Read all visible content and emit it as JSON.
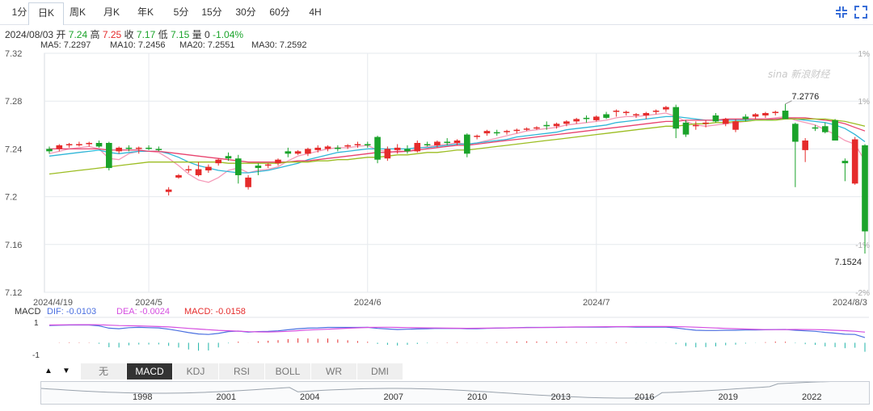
{
  "tabs": {
    "items": [
      "1分",
      "日K",
      "周K",
      "月K",
      "年K",
      "5分",
      "15分",
      "30分",
      "60分",
      "4H"
    ],
    "active": "日K"
  },
  "info": {
    "date": "2024/08/03",
    "open_label": "开",
    "open": "7.24",
    "high_label": "高",
    "high": "7.25",
    "close_label": "收",
    "close": "7.17",
    "low_label": "低",
    "low": "7.15",
    "volume_label": "量",
    "volume": "0",
    "change": "-1.04%"
  },
  "ma_legend": [
    {
      "label": "MA5: 7.2297",
      "color": "#f59ab8"
    },
    {
      "label": "MA10: 7.2456",
      "color": "#2fb6d8"
    },
    {
      "label": "MA20: 7.2551",
      "color": "#e8436e"
    },
    {
      "label": "MA30: 7.2592",
      "color": "#9cbd22"
    }
  ],
  "colors": {
    "up": "#e52b2b",
    "down": "#1aa32a",
    "grid": "#e6e9ee",
    "axis": "#555"
  },
  "watermark": "新浪财经",
  "chart_data": {
    "type": "candlestick",
    "y_ticks": [
      "7.32",
      "7.28",
      "7.24",
      "7.2",
      "7.16",
      "7.12"
    ],
    "y_tick_values": [
      7.32,
      7.28,
      7.24,
      7.2,
      7.16,
      7.12
    ],
    "ylim": [
      7.12,
      7.32
    ],
    "pct_ticks": [
      "1%",
      "1%",
      "-1%",
      "-2%"
    ],
    "x_labels": [
      "2024/4/19",
      "2024/5",
      "2024/6",
      "2024/7",
      "2024/8/3"
    ],
    "annotations": {
      "max": "7.2776",
      "min": "7.1524"
    },
    "candles": [
      [
        7.24,
        7.242,
        7.236,
        7.238
      ],
      [
        7.24,
        7.244,
        7.238,
        7.243
      ],
      [
        7.243,
        7.245,
        7.241,
        7.244
      ],
      [
        7.244,
        7.246,
        7.242,
        7.244
      ],
      [
        7.244,
        7.246,
        7.242,
        7.245
      ],
      [
        7.245,
        7.247,
        7.241,
        7.242
      ],
      [
        7.245,
        7.246,
        7.222,
        7.224
      ],
      [
        7.238,
        7.242,
        7.236,
        7.241
      ],
      [
        7.241,
        7.243,
        7.238,
        7.24
      ],
      [
        7.24,
        7.242,
        7.236,
        7.241
      ],
      [
        7.241,
        7.243,
        7.239,
        7.24
      ],
      [
        7.24,
        7.242,
        7.238,
        7.239
      ],
      [
        7.204,
        7.208,
        7.201,
        7.206
      ],
      [
        7.216,
        7.219,
        7.215,
        7.218
      ],
      [
        7.222,
        7.226,
        7.22,
        7.223
      ],
      [
        7.218,
        7.229,
        7.217,
        7.223
      ],
      [
        7.222,
        7.227,
        7.22,
        7.225
      ],
      [
        7.228,
        7.232,
        7.226,
        7.231
      ],
      [
        7.234,
        7.237,
        7.23,
        7.232
      ],
      [
        7.232,
        7.235,
        7.211,
        7.218
      ],
      [
        7.208,
        7.218,
        7.206,
        7.216
      ],
      [
        7.226,
        7.228,
        7.218,
        7.224
      ],
      [
        7.226,
        7.228,
        7.224,
        7.227
      ],
      [
        7.228,
        7.232,
        7.226,
        7.231
      ],
      [
        7.238,
        7.241,
        7.233,
        7.236
      ],
      [
        7.236,
        7.239,
        7.235,
        7.238
      ],
      [
        7.236,
        7.241,
        7.234,
        7.24
      ],
      [
        7.239,
        7.243,
        7.237,
        7.241
      ],
      [
        7.24,
        7.243,
        7.238,
        7.242
      ],
      [
        7.241,
        7.243,
        7.238,
        7.24
      ],
      [
        7.242,
        7.244,
        7.24,
        7.243
      ],
      [
        7.243,
        7.246,
        7.241,
        7.244
      ],
      [
        7.244,
        7.246,
        7.241,
        7.243
      ],
      [
        7.25,
        7.251,
        7.228,
        7.231
      ],
      [
        7.232,
        7.242,
        7.23,
        7.24
      ],
      [
        7.239,
        7.244,
        7.236,
        7.241
      ],
      [
        7.24,
        7.243,
        7.236,
        7.238
      ],
      [
        7.238,
        7.247,
        7.237,
        7.245
      ],
      [
        7.244,
        7.246,
        7.242,
        7.243
      ],
      [
        7.243,
        7.247,
        7.241,
        7.246
      ],
      [
        7.246,
        7.249,
        7.243,
        7.245
      ],
      [
        7.245,
        7.248,
        7.243,
        7.247
      ],
      [
        7.252,
        7.253,
        7.233,
        7.236
      ],
      [
        7.25,
        7.252,
        7.248,
        7.251
      ],
      [
        7.253,
        7.256,
        7.251,
        7.255
      ],
      [
        7.254,
        7.256,
        7.251,
        7.253
      ],
      [
        7.254,
        7.256,
        7.252,
        7.255
      ],
      [
        7.255,
        7.257,
        7.253,
        7.256
      ],
      [
        7.256,
        7.258,
        7.255,
        7.257
      ],
      [
        7.257,
        7.259,
        7.256,
        7.258
      ],
      [
        7.26,
        7.263,
        7.256,
        7.259
      ],
      [
        7.259,
        7.262,
        7.257,
        7.261
      ],
      [
        7.261,
        7.264,
        7.259,
        7.263
      ],
      [
        7.263,
        7.266,
        7.261,
        7.265
      ],
      [
        7.266,
        7.268,
        7.262,
        7.265
      ],
      [
        7.264,
        7.268,
        7.263,
        7.267
      ],
      [
        7.269,
        7.271,
        7.265,
        7.266
      ],
      [
        7.271,
        7.273,
        7.267,
        7.272
      ],
      [
        7.27,
        7.272,
        7.268,
        7.271
      ],
      [
        7.268,
        7.27,
        7.266,
        7.269
      ],
      [
        7.268,
        7.271,
        7.265,
        7.27
      ],
      [
        7.271,
        7.273,
        7.269,
        7.272
      ],
      [
        7.273,
        7.276,
        7.271,
        7.275
      ],
      [
        7.275,
        7.277,
        7.249,
        7.257
      ],
      [
        7.262,
        7.264,
        7.25,
        7.252
      ],
      [
        7.259,
        7.263,
        7.256,
        7.26
      ],
      [
        7.261,
        7.264,
        7.258,
        7.262
      ],
      [
        7.268,
        7.27,
        7.262,
        7.263
      ],
      [
        7.261,
        7.266,
        7.259,
        7.265
      ],
      [
        7.256,
        7.265,
        7.254,
        7.263
      ],
      [
        7.267,
        7.269,
        7.263,
        7.265
      ],
      [
        7.267,
        7.27,
        7.265,
        7.269
      ],
      [
        7.268,
        7.271,
        7.266,
        7.27
      ],
      [
        7.27,
        7.272,
        7.268,
        7.271
      ],
      [
        7.272,
        7.2776,
        7.265,
        7.265
      ],
      [
        7.261,
        7.262,
        7.208,
        7.246
      ],
      [
        7.239,
        7.249,
        7.229,
        7.247
      ],
      [
        7.258,
        7.26,
        7.255,
        7.257
      ],
      [
        7.259,
        7.262,
        7.253,
        7.254
      ],
      [
        7.264,
        7.265,
        7.249,
        7.247
      ],
      [
        7.23,
        7.232,
        7.213,
        7.228
      ],
      [
        7.211,
        7.25,
        7.21,
        7.248
      ],
      [
        7.243,
        7.244,
        7.1524,
        7.171
      ]
    ],
    "ma5": [
      7.236,
      7.238,
      7.24,
      7.241,
      7.242,
      7.24,
      7.232,
      7.231,
      7.236,
      7.238,
      7.238,
      7.237,
      7.232,
      7.226,
      7.219,
      7.214,
      7.212,
      7.216,
      7.222,
      7.224,
      7.22,
      7.222,
      7.223,
      7.225,
      7.23,
      7.234,
      7.236,
      7.238,
      7.24,
      7.241,
      7.241,
      7.242,
      7.243,
      7.239,
      7.238,
      7.237,
      7.238,
      7.24,
      7.242,
      7.243,
      7.244,
      7.245,
      7.244,
      7.245,
      7.247,
      7.249,
      7.251,
      7.253,
      7.255,
      7.256,
      7.257,
      7.258,
      7.26,
      7.261,
      7.262,
      7.263,
      7.264,
      7.266,
      7.267,
      7.267,
      7.268,
      7.269,
      7.27,
      7.267,
      7.263,
      7.26,
      7.259,
      7.26,
      7.261,
      7.262,
      7.263,
      7.264,
      7.265,
      7.266,
      7.267,
      7.264,
      7.262,
      7.26,
      7.256,
      7.252,
      7.247,
      7.244,
      7.23
    ],
    "ma10": [
      7.234,
      7.235,
      7.236,
      7.237,
      7.238,
      7.239,
      7.237,
      7.236,
      7.237,
      7.238,
      7.238,
      7.238,
      7.236,
      7.233,
      7.229,
      7.226,
      7.224,
      7.222,
      7.221,
      7.22,
      7.22,
      7.221,
      7.222,
      7.224,
      7.226,
      7.228,
      7.231,
      7.233,
      7.235,
      7.237,
      7.238,
      7.239,
      7.24,
      7.24,
      7.24,
      7.24,
      7.24,
      7.241,
      7.241,
      7.242,
      7.243,
      7.244,
      7.244,
      7.245,
      7.246,
      7.247,
      7.248,
      7.25,
      7.251,
      7.252,
      7.253,
      7.254,
      7.256,
      7.257,
      7.258,
      7.259,
      7.26,
      7.262,
      7.263,
      7.264,
      7.265,
      7.266,
      7.267,
      7.267,
      7.266,
      7.265,
      7.264,
      7.264,
      7.264,
      7.264,
      7.264,
      7.264,
      7.264,
      7.265,
      7.265,
      7.265,
      7.264,
      7.263,
      7.262,
      7.26,
      7.257,
      7.252,
      7.246
    ],
    "ma20": [
      7.24,
      7.24,
      7.24,
      7.24,
      7.24,
      7.24,
      7.239,
      7.239,
      7.239,
      7.239,
      7.238,
      7.238,
      7.237,
      7.236,
      7.235,
      7.234,
      7.233,
      7.232,
      7.231,
      7.23,
      7.229,
      7.229,
      7.229,
      7.229,
      7.229,
      7.23,
      7.23,
      7.231,
      7.232,
      7.233,
      7.234,
      7.235,
      7.236,
      7.237,
      7.237,
      7.238,
      7.238,
      7.239,
      7.24,
      7.241,
      7.242,
      7.243,
      7.243,
      7.244,
      7.245,
      7.246,
      7.247,
      7.248,
      7.249,
      7.25,
      7.251,
      7.252,
      7.253,
      7.254,
      7.255,
      7.256,
      7.257,
      7.258,
      7.259,
      7.26,
      7.261,
      7.262,
      7.263,
      7.263,
      7.264,
      7.264,
      7.264,
      7.264,
      7.265,
      7.265,
      7.265,
      7.265,
      7.265,
      7.265,
      7.266,
      7.266,
      7.266,
      7.265,
      7.264,
      7.263,
      7.261,
      7.258,
      7.255
    ],
    "ma30": [
      7.219,
      7.22,
      7.221,
      7.222,
      7.223,
      7.224,
      7.225,
      7.226,
      7.227,
      7.228,
      7.229,
      7.229,
      7.229,
      7.229,
      7.229,
      7.229,
      7.229,
      7.229,
      7.228,
      7.228,
      7.228,
      7.228,
      7.228,
      7.228,
      7.229,
      7.229,
      7.229,
      7.23,
      7.23,
      7.231,
      7.231,
      7.232,
      7.233,
      7.233,
      7.234,
      7.235,
      7.235,
      7.236,
      7.237,
      7.237,
      7.238,
      7.239,
      7.239,
      7.24,
      7.241,
      7.242,
      7.243,
      7.244,
      7.245,
      7.246,
      7.247,
      7.248,
      7.249,
      7.25,
      7.251,
      7.252,
      7.253,
      7.254,
      7.255,
      7.256,
      7.257,
      7.258,
      7.259,
      7.259,
      7.26,
      7.261,
      7.261,
      7.262,
      7.262,
      7.263,
      7.263,
      7.264,
      7.264,
      7.264,
      7.265,
      7.265,
      7.265,
      7.265,
      7.265,
      7.264,
      7.263,
      7.261,
      7.259
    ],
    "macd": {
      "label": "MACD",
      "dif_label": "DIF: -0.0103",
      "dea_label": "DEA: -0.0024",
      "macd_label": "MACD: -0.0158",
      "y_ticks": [
        "1",
        "-1"
      ]
    },
    "indicator_tabs": [
      "无",
      "MACD",
      "KDJ",
      "RSI",
      "BOLL",
      "WR",
      "DMI"
    ],
    "indicator_active": "MACD",
    "timeline_labels": [
      "1998",
      "2001",
      "2004",
      "2007",
      "2010",
      "2013",
      "2016",
      "2019",
      "2022"
    ]
  }
}
